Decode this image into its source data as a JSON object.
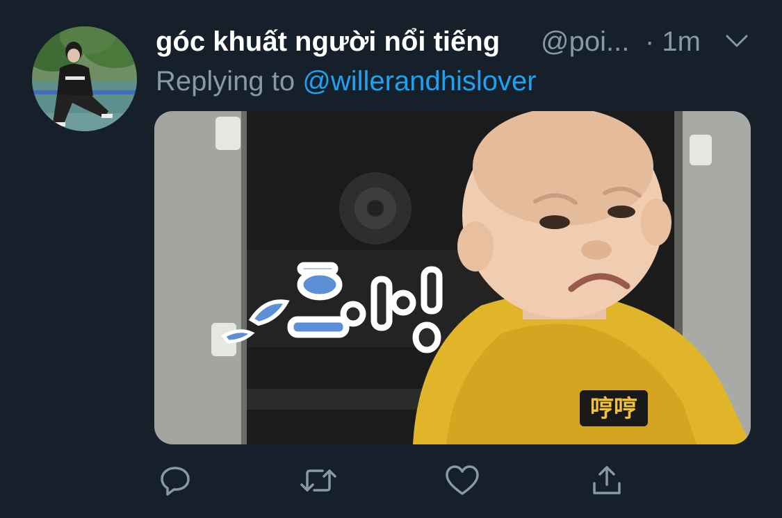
{
  "tweet": {
    "display_name": "góc khuất người nổi tiếng",
    "handle": "@poi...",
    "timestamp": "· 1m",
    "reply_prefix": "Replying to",
    "reply_to": "@willerandhislover",
    "avatar_icon": "profile-photo",
    "media": {
      "kind": "gif-image",
      "caption_korean": "흐이잉",
      "caption_chinese": "哼哼"
    }
  },
  "actions": {
    "reply_icon": "reply-icon",
    "retweet_icon": "retweet-icon",
    "like_icon": "heart-icon",
    "share_icon": "share-icon"
  },
  "colors": {
    "background": "#15202b",
    "primary_text": "#ffffff",
    "secondary_text": "#8899a6",
    "link": "#1da1f2"
  }
}
